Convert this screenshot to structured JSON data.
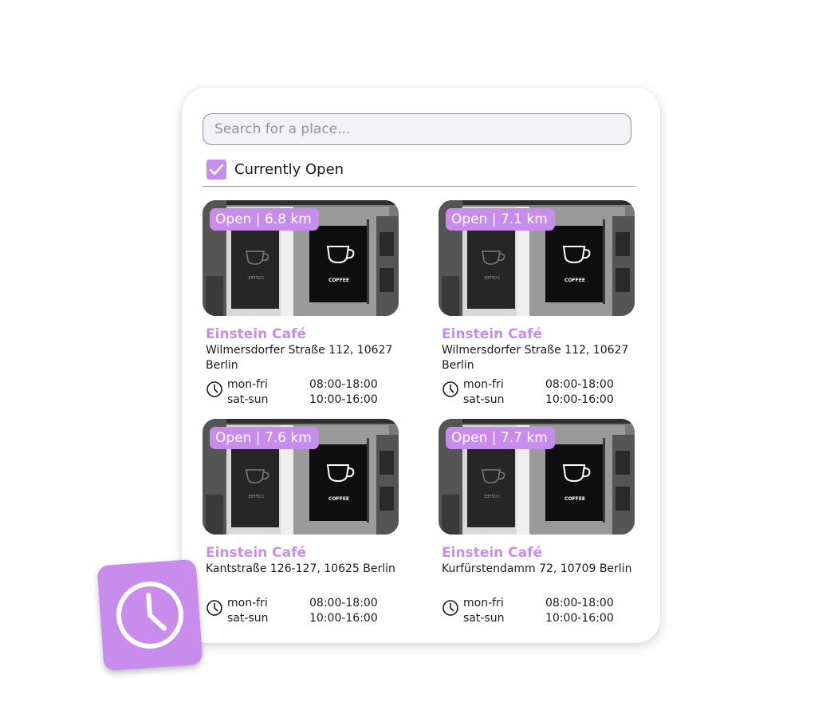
{
  "search": {
    "placeholder": "Search for a place..."
  },
  "filter": {
    "label": "Currently Open",
    "checked": true
  },
  "accent_color": "#c88cec",
  "cards": [
    {
      "badge": "Open | 6.8 km",
      "name": "Einstein Café",
      "address": "Wilmersdorfer Straße 112, 10627 Berlin",
      "hours": [
        {
          "days": "mon-fri",
          "time": "08:00-18:00"
        },
        {
          "days": "sat-sun",
          "time": "10:00-16:00"
        }
      ]
    },
    {
      "badge": "Open | 7.1 km",
      "name": "Einstein Café",
      "address": "Wilmersdorfer Straße 112, 10627 Berlin",
      "hours": [
        {
          "days": "mon-fri",
          "time": "08:00-18:00"
        },
        {
          "days": "sat-sun",
          "time": "10:00-16:00"
        }
      ]
    },
    {
      "badge": "Open | 7.6 km",
      "name": "Einstein Café",
      "address": "Kantstraße 126-127, 10625 Berlin",
      "hours": [
        {
          "days": "mon-fri",
          "time": "08:00-18:00"
        },
        {
          "days": "sat-sun",
          "time": "10:00-16:00"
        }
      ]
    },
    {
      "badge": "Open | 7.7 km",
      "name": "Einstein Café",
      "address": "Kurfürstendamm 72, 10709 Berlin",
      "hours": [
        {
          "days": "mon-fri",
          "time": "08:00-18:00"
        },
        {
          "days": "sat-sun",
          "time": "10:00-16:00"
        }
      ]
    }
  ],
  "photo": {
    "sign_text": "COFFEE",
    "sign_text_mirrored": "COFFEE"
  },
  "icons": {
    "checkbox": "check-icon",
    "hours": "clock-icon",
    "badge": "clock-icon",
    "photo_sign": "coffee-cup-icon"
  }
}
